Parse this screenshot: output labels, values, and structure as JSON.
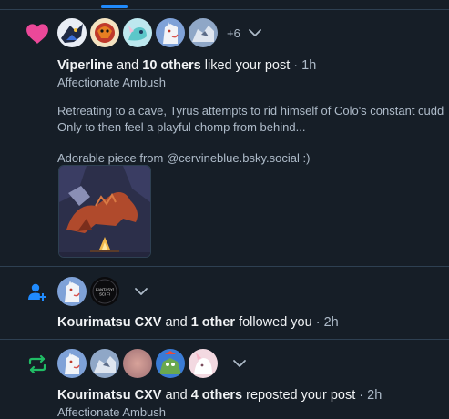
{
  "notifications": [
    {
      "type": "like",
      "icon": "heart-icon",
      "icon_color": "#ec4899",
      "more_count": "+6",
      "actor": "Viperline",
      "joiner": "and",
      "others": "10 others",
      "action": "liked your post",
      "dot": "·",
      "time": "1h",
      "post_title": "Affectionate Ambush",
      "post_lines": [
        "Retreating to a cave, Tyrus attempts to rid himself of Colo's constant cudd",
        "Only to then feel a playful chomp from behind...",
        "",
        "Adorable piece from @cervineblue.bsky.social :)"
      ]
    },
    {
      "type": "follow",
      "icon": "person-plus-icon",
      "icon_color": "#208bfe",
      "actor": "Kourimatsu CXV",
      "joiner": "and",
      "others": "1 other",
      "action": "followed you",
      "dot": "·",
      "time": "2h",
      "badge_text": "FANTASY / SCI FI"
    },
    {
      "type": "repost",
      "icon": "repost-icon",
      "icon_color": "#20bc65",
      "actor": "Kourimatsu CXV",
      "joiner": "and",
      "others": "4 others",
      "action": "reposted your post",
      "dot": "·",
      "time": "2h",
      "post_title": "Affectionate Ambush"
    }
  ],
  "colors": {
    "background": "#161e27",
    "separator": "#2e4052",
    "text": "#f1f3f5",
    "muted": "#aebbc9",
    "accent": "#208bfe"
  }
}
